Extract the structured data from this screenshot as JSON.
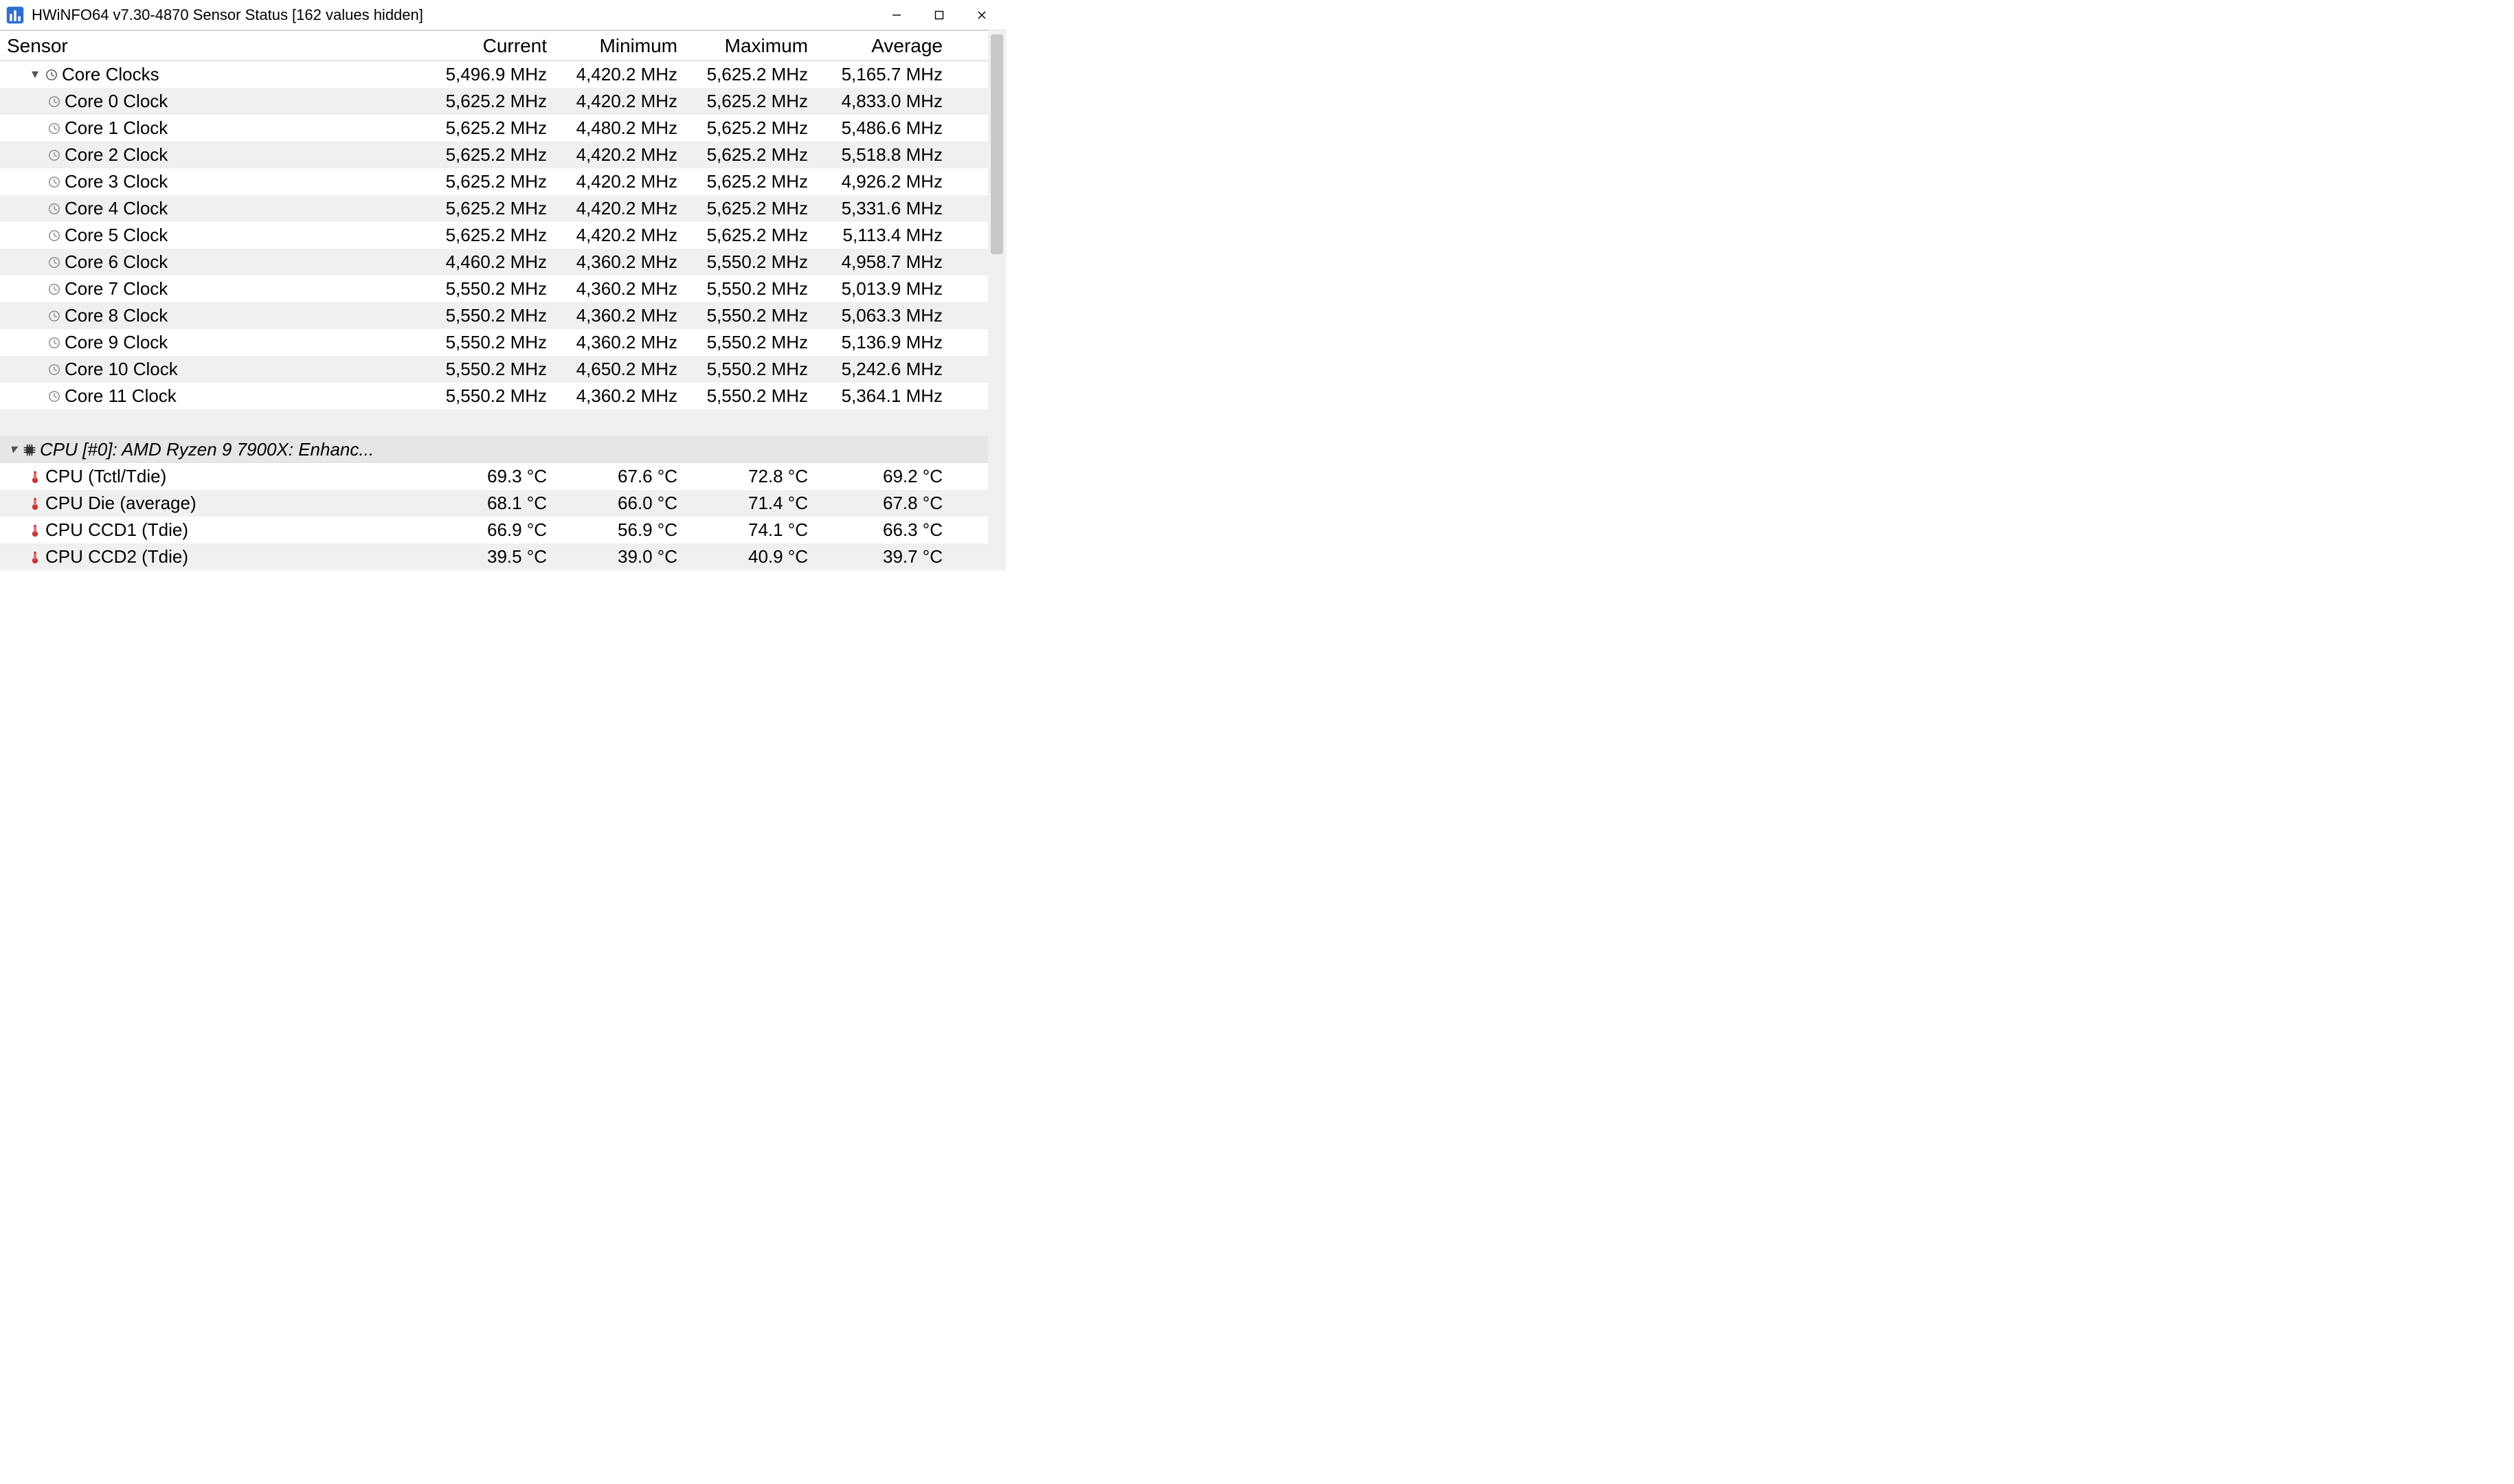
{
  "window": {
    "title": "HWiNFO64 v7.30-4870 Sensor Status [162 values hidden]"
  },
  "columns": {
    "sensor": "Sensor",
    "current": "Current",
    "minimum": "Minimum",
    "maximum": "Maximum",
    "average": "Average"
  },
  "groups": {
    "coreClocks": {
      "label": "Core Clocks",
      "current": "5,496.9 MHz",
      "minimum": "4,420.2 MHz",
      "maximum": "5,625.2 MHz",
      "average": "5,165.7 MHz",
      "rows": [
        {
          "label": "Core 0 Clock",
          "current": "5,625.2 MHz",
          "minimum": "4,420.2 MHz",
          "maximum": "5,625.2 MHz",
          "average": "4,833.0 MHz"
        },
        {
          "label": "Core 1 Clock",
          "current": "5,625.2 MHz",
          "minimum": "4,480.2 MHz",
          "maximum": "5,625.2 MHz",
          "average": "5,486.6 MHz"
        },
        {
          "label": "Core 2 Clock",
          "current": "5,625.2 MHz",
          "minimum": "4,420.2 MHz",
          "maximum": "5,625.2 MHz",
          "average": "5,518.8 MHz"
        },
        {
          "label": "Core 3 Clock",
          "current": "5,625.2 MHz",
          "minimum": "4,420.2 MHz",
          "maximum": "5,625.2 MHz",
          "average": "4,926.2 MHz"
        },
        {
          "label": "Core 4 Clock",
          "current": "5,625.2 MHz",
          "minimum": "4,420.2 MHz",
          "maximum": "5,625.2 MHz",
          "average": "5,331.6 MHz"
        },
        {
          "label": "Core 5 Clock",
          "current": "5,625.2 MHz",
          "minimum": "4,420.2 MHz",
          "maximum": "5,625.2 MHz",
          "average": "5,113.4 MHz"
        },
        {
          "label": "Core 6 Clock",
          "current": "4,460.2 MHz",
          "minimum": "4,360.2 MHz",
          "maximum": "5,550.2 MHz",
          "average": "4,958.7 MHz"
        },
        {
          "label": "Core 7 Clock",
          "current": "5,550.2 MHz",
          "minimum": "4,360.2 MHz",
          "maximum": "5,550.2 MHz",
          "average": "5,013.9 MHz"
        },
        {
          "label": "Core 8 Clock",
          "current": "5,550.2 MHz",
          "minimum": "4,360.2 MHz",
          "maximum": "5,550.2 MHz",
          "average": "5,063.3 MHz"
        },
        {
          "label": "Core 9 Clock",
          "current": "5,550.2 MHz",
          "minimum": "4,360.2 MHz",
          "maximum": "5,550.2 MHz",
          "average": "5,136.9 MHz"
        },
        {
          "label": "Core 10 Clock",
          "current": "5,550.2 MHz",
          "minimum": "4,650.2 MHz",
          "maximum": "5,550.2 MHz",
          "average": "5,242.6 MHz"
        },
        {
          "label": "Core 11 Clock",
          "current": "5,550.2 MHz",
          "minimum": "4,360.2 MHz",
          "maximum": "5,550.2 MHz",
          "average": "5,364.1 MHz"
        }
      ]
    },
    "cpuEnhanced": {
      "label": "CPU [#0]: AMD Ryzen 9 7900X: Enhanc...",
      "rows": [
        {
          "label": "CPU (Tctl/Tdie)",
          "current": "69.3 °C",
          "minimum": "67.6 °C",
          "maximum": "72.8 °C",
          "average": "69.2 °C"
        },
        {
          "label": "CPU Die (average)",
          "current": "68.1 °C",
          "minimum": "66.0 °C",
          "maximum": "71.4 °C",
          "average": "67.8 °C"
        },
        {
          "label": "CPU CCD1 (Tdie)",
          "current": "66.9 °C",
          "minimum": "56.9 °C",
          "maximum": "74.1 °C",
          "average": "66.3 °C"
        },
        {
          "label": "CPU CCD2 (Tdie)",
          "current": "39.5 °C",
          "minimum": "39.0 °C",
          "maximum": "40.9 °C",
          "average": "39.7 °C"
        }
      ]
    }
  }
}
